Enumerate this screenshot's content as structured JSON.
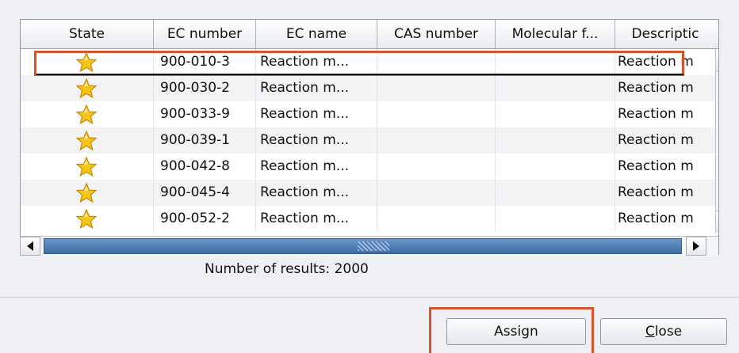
{
  "table": {
    "columns": [
      "State",
      "EC number",
      "EC name",
      "CAS number",
      "Molecular f...",
      "Descriptic"
    ],
    "rows": [
      {
        "state_icon": "star-icon",
        "ec_number": "900-010-3",
        "ec_name": "Reaction m...",
        "cas": "",
        "formula": "",
        "description": "Reaction m"
      },
      {
        "state_icon": "star-icon",
        "ec_number": "900-030-2",
        "ec_name": "Reaction m...",
        "cas": "",
        "formula": "",
        "description": "Reaction m"
      },
      {
        "state_icon": "star-icon",
        "ec_number": "900-033-9",
        "ec_name": "Reaction m...",
        "cas": "",
        "formula": "",
        "description": "Reaction m"
      },
      {
        "state_icon": "star-icon",
        "ec_number": "900-039-1",
        "ec_name": "Reaction m...",
        "cas": "",
        "formula": "",
        "description": "Reaction m"
      },
      {
        "state_icon": "star-icon",
        "ec_number": "900-042-8",
        "ec_name": "Reaction m...",
        "cas": "",
        "formula": "",
        "description": "Reaction m"
      },
      {
        "state_icon": "star-icon",
        "ec_number": "900-045-4",
        "ec_name": "Reaction m...",
        "cas": "",
        "formula": "",
        "description": "Reaction m"
      },
      {
        "state_icon": "star-icon",
        "ec_number": "900-052-2",
        "ec_name": "Reaction m...",
        "cas": "",
        "formula": "",
        "description": "Reaction m"
      }
    ]
  },
  "results_text": "Number of results: 2000",
  "buttons": {
    "assign": "Assign",
    "close_mnemonic": "C",
    "close_rest": "lose"
  },
  "colors": {
    "highlight": "#d9542b",
    "star": "#f5c518",
    "scroll_thumb": "#3e6ea6"
  }
}
